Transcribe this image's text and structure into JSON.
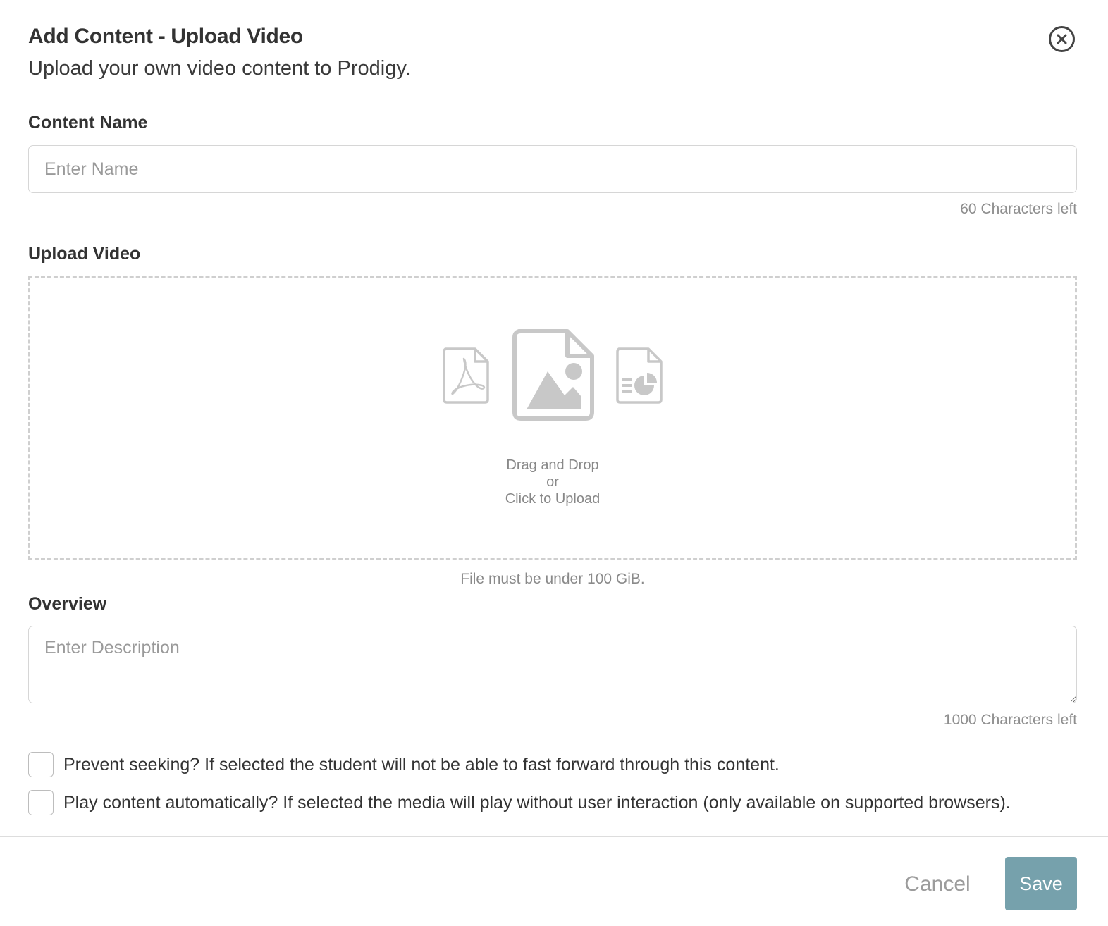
{
  "modal": {
    "title": "Add Content - Upload Video",
    "subtitle": "Upload your own video content to Prodigy.",
    "close_icon": "close-circle-icon"
  },
  "content_name": {
    "label": "Content Name",
    "value": "",
    "placeholder": "Enter Name",
    "chars_left": "60 Characters left"
  },
  "upload": {
    "label": "Upload Video",
    "icons": [
      "pdf-file-icon",
      "image-file-icon",
      "report-file-icon"
    ],
    "line1": "Drag and Drop",
    "line2": "or",
    "line3": "Click to Upload",
    "note": "File must be under 100 GiB."
  },
  "overview": {
    "label": "Overview",
    "value": "",
    "placeholder": "Enter Description",
    "chars_left": "1000 Characters left"
  },
  "options": [
    {
      "label": "Prevent seeking? If selected the student will not be able to fast forward through this content.",
      "checked": false
    },
    {
      "label": "Play content automatically? If selected the media will play without user interaction (only available on supported browsers).",
      "checked": false
    }
  ],
  "footer": {
    "cancel_label": "Cancel",
    "save_label": "Save"
  },
  "colors": {
    "save_button": "#76a1ac",
    "muted_text": "#8e8e8e",
    "icon_gray": "#c8c8c8"
  }
}
